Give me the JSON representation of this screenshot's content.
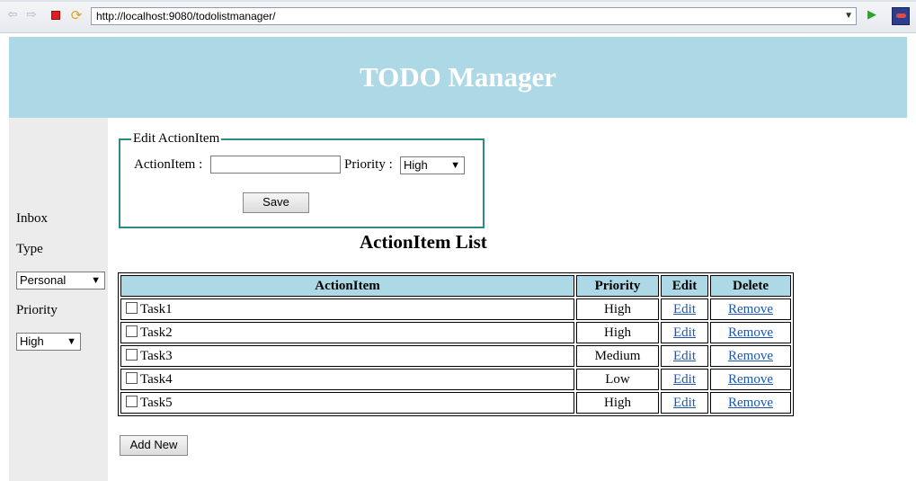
{
  "browser": {
    "url": "http://localhost:9080/todolistmanager/"
  },
  "header": {
    "title": "TODO Manager"
  },
  "sidebar": {
    "inbox_label": "Inbox",
    "type_label": "Type",
    "type_value": "Personal",
    "priority_label": "Priority",
    "priority_value": "High"
  },
  "edit_form": {
    "legend": "Edit ActionItem",
    "action_item_label": "ActionItem :",
    "action_item_value": "",
    "priority_label": "Priority :",
    "priority_value": "High",
    "save_label": "Save"
  },
  "list": {
    "title": "ActionItem List",
    "columns": [
      "ActionItem",
      "Priority",
      "Edit",
      "Delete"
    ],
    "rows": [
      {
        "task": "Task1",
        "priority": "High",
        "edit": "Edit",
        "remove": "Remove"
      },
      {
        "task": "Task2",
        "priority": "High",
        "edit": "Edit",
        "remove": "Remove"
      },
      {
        "task": "Task3",
        "priority": "Medium",
        "edit": "Edit",
        "remove": "Remove"
      },
      {
        "task": "Task4",
        "priority": "Low",
        "edit": "Edit",
        "remove": "Remove"
      },
      {
        "task": "Task5",
        "priority": "High",
        "edit": "Edit",
        "remove": "Remove"
      }
    ],
    "add_new_label": "Add New"
  },
  "colors": {
    "header_bg": "#add8e6",
    "sidebar_bg": "#ececec",
    "fieldset_border": "#2e8b87",
    "link": "#1a56b4"
  },
  "icons": [
    "back-icon",
    "forward-icon",
    "stop-icon",
    "refresh-icon",
    "go-icon",
    "app-icon"
  ]
}
